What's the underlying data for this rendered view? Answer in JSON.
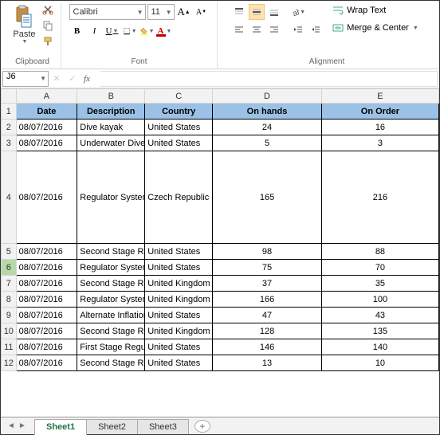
{
  "ribbon": {
    "clipboard": {
      "paste_label": "Paste",
      "group_label": "Clipboard"
    },
    "font": {
      "name": "Calibri",
      "size": "11",
      "bold": "B",
      "italic": "I",
      "underline": "U",
      "incfont": "A",
      "decfont": "A",
      "group_label": "Font"
    },
    "alignment": {
      "wrap_label": "Wrap Text",
      "merge_label": "Merge & Center",
      "group_label": "Alignment"
    }
  },
  "namebox": "J6",
  "fx_label": "fx",
  "columns": [
    "A",
    "B",
    "C",
    "D",
    "E"
  ],
  "headers": {
    "date": "Date",
    "description": "Description",
    "country": "Country",
    "onhands": "On hands",
    "onorder": "On Order"
  },
  "rows": [
    {
      "n": "2",
      "date": "08/07/2016",
      "desc": "Dive kayak",
      "country": "United States",
      "hands": "24",
      "order": "16",
      "tall": false
    },
    {
      "n": "3",
      "date": "08/07/2016",
      "desc": "Underwater Diver Vehicle",
      "country": "United States",
      "hands": "5",
      "order": "3",
      "tall": false
    },
    {
      "n": "4",
      "date": "08/07/2016",
      "desc": "Regulator System",
      "country": "Czech Republic",
      "hands": "165",
      "order": "216",
      "tall": true
    },
    {
      "n": "5",
      "date": "08/07/2016",
      "desc": "Second Stage Regulator",
      "country": "United States",
      "hands": "98",
      "order": "88",
      "tall": false
    },
    {
      "n": "6",
      "date": "08/07/2016",
      "desc": "Regulator System",
      "country": "United States",
      "hands": "75",
      "order": "70",
      "tall": false
    },
    {
      "n": "7",
      "date": "08/07/2016",
      "desc": "Second Stage Regulator",
      "country": "United Kingdom",
      "hands": "37",
      "order": "35",
      "tall": false
    },
    {
      "n": "8",
      "date": "08/07/2016",
      "desc": "Regulator System",
      "country": "United Kingdom",
      "hands": "166",
      "order": "100",
      "tall": false
    },
    {
      "n": "9",
      "date": "08/07/2016",
      "desc": "Alternate Inflation Regulator",
      "country": "United States",
      "hands": "47",
      "order": "43",
      "tall": false
    },
    {
      "n": "10",
      "date": "08/07/2016",
      "desc": "Second Stage Regulator",
      "country": "United Kingdom",
      "hands": "128",
      "order": "135",
      "tall": false
    },
    {
      "n": "11",
      "date": "08/07/2016",
      "desc": "First Stage Regulator",
      "country": "United States",
      "hands": "146",
      "order": "140",
      "tall": false
    },
    {
      "n": "12",
      "date": "08/07/2016",
      "desc": "Second Stage Regulator",
      "country": "United States",
      "hands": "13",
      "order": "10",
      "tall": false
    }
  ],
  "sheets": {
    "s1": "Sheet1",
    "s2": "Sheet2",
    "s3": "Sheet3"
  },
  "selected_row": "6",
  "colwidths": {
    "rh": 18,
    "A": 74,
    "B": 82,
    "C": 82,
    "D": 132,
    "E": 142
  }
}
